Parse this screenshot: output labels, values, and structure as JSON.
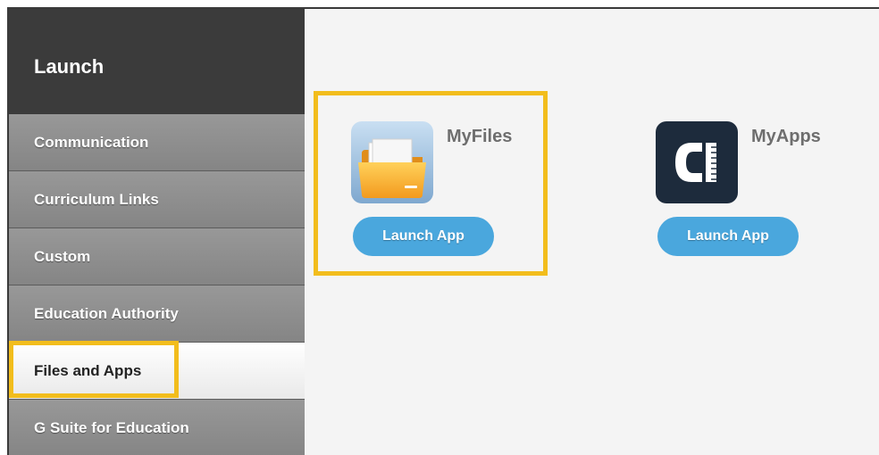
{
  "sidebar": {
    "title": "Launch",
    "active_index": 4,
    "items": [
      {
        "label": "Communication"
      },
      {
        "label": "Curriculum Links"
      },
      {
        "label": "Custom"
      },
      {
        "label": "Education Authority"
      },
      {
        "label": "Files and Apps"
      },
      {
        "label": "G Suite for Education"
      }
    ]
  },
  "apps": [
    {
      "name": "MyFiles",
      "icon": "folder-icon",
      "button_label": "Launch App"
    },
    {
      "name": "MyApps",
      "icon": "myapps-logo-icon",
      "button_label": "Launch App"
    }
  ],
  "colors": {
    "highlight": "#f2bd1c",
    "button": "#4aa7dd",
    "sidebar_header": "#3b3b3b",
    "sidebar_item": "#8c8c8c"
  }
}
